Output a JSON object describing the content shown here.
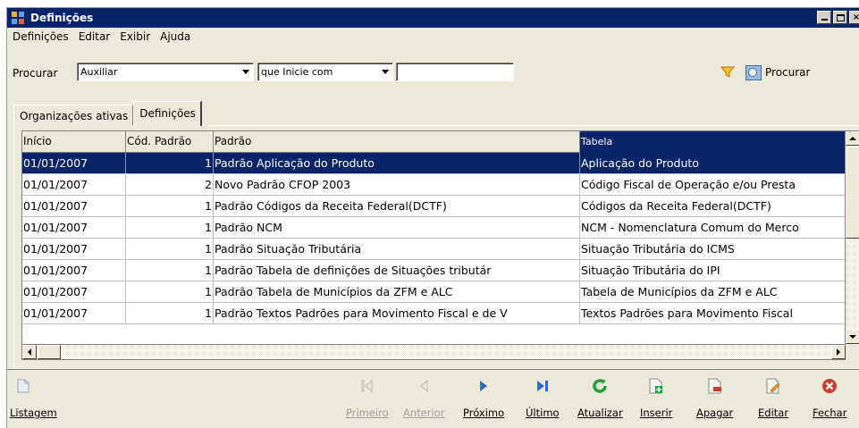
{
  "window": {
    "title": "Definições",
    "buttons": {
      "minimize": "_",
      "maximize": "□",
      "close": "×"
    }
  },
  "menu": [
    "Definições",
    "Editar",
    "Exibir",
    "Ajuda"
  ],
  "search": {
    "label": "Procurar",
    "field_value": "Auxiliar",
    "mode_value": "que Inicie com",
    "text_value": "",
    "button_label": "Procurar"
  },
  "tabs": [
    {
      "label": "Organizações ativas",
      "active": false
    },
    {
      "label": "Definições",
      "active": true
    }
  ],
  "grid": {
    "columns": [
      "Início",
      "Cód. Padrão",
      "Padrão",
      "Tabela"
    ],
    "rows": [
      [
        "01/01/2007",
        "1",
        "Padrão Aplicação do Produto",
        "Aplicação do Produto"
      ],
      [
        "01/01/2007",
        "2",
        "Novo Padrão CFOP 2003",
        "Código Fiscal de Operação e/ou Presta"
      ],
      [
        "01/01/2007",
        "1",
        "Padrão Códigos da Receita Federal(DCTF)",
        "Códigos da Receita Federal(DCTF)"
      ],
      [
        "01/01/2007",
        "1",
        "Padrão NCM",
        "NCM - Nomenclatura Comum do Merco"
      ],
      [
        "01/01/2007",
        "1",
        "Padrão Situação Tributária",
        "Situação Tributária do ICMS"
      ],
      [
        "01/01/2007",
        "1",
        "Padrão  Tabela de definições de Situações tributár",
        "Situação Tributária do IPI"
      ],
      [
        "01/01/2007",
        "1",
        "Padrão Tabela de Municípios da ZFM e ALC",
        "Tabela de Municípios da ZFM e ALC"
      ],
      [
        "01/01/2007",
        "1",
        "Padrão Textos Padrões para Movimento Fiscal e de V",
        "Textos Padrões para Movimento Fiscal"
      ]
    ],
    "selected_row": 0
  },
  "toolbar": {
    "listagem": "Listagem",
    "primeiro": "Primeiro",
    "anterior": "Anterior",
    "proximo": "Próximo",
    "ultimo": "Último",
    "atualizar": "Atualizar",
    "inserir": "Inserir",
    "apagar": "Apagar",
    "editar": "Editar",
    "fechar": "Fechar"
  },
  "colors": {
    "titlebar": "#0a246a",
    "selection": "#0a246a",
    "face": "#ece9d8",
    "nav_blue": "#2a6cc8",
    "refresh_green": "#2a9a3a",
    "close_red": "#d03a2a"
  }
}
